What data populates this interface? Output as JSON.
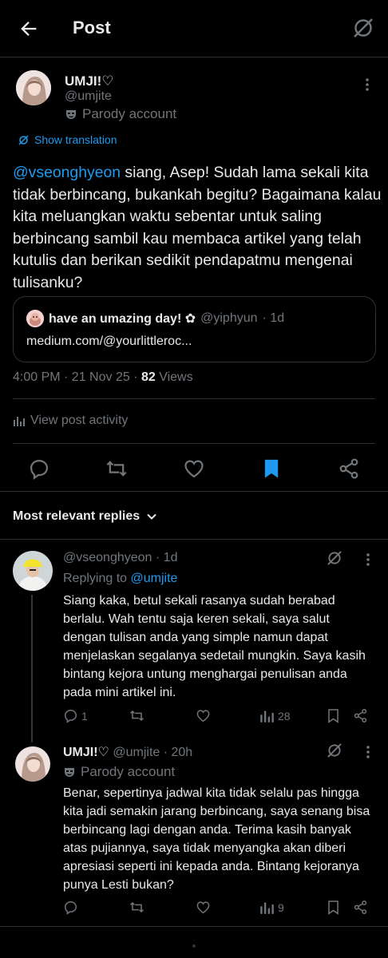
{
  "header": {
    "title": "Post"
  },
  "post": {
    "author_name": "UMJI!♡",
    "author_handle": "@umjite",
    "parody_label": "Parody account",
    "show_translation": "Show translation",
    "mention": "@vseonghyeon",
    "text": " siang, Asep! Sudah lama sekali kita tidak berbincang, bukankah begitu? Bagaimana kalau kita meluangkan waktu sebentar untuk saling berbincang sambil kau membaca artikel yang telah kutulis dan berikan sedikit pendapatmu mengenai tulisanku?",
    "quote": {
      "name": "have an umazing day! ✿",
      "handle": "@yiphyun",
      "age": "· 1d",
      "link": "medium.com/@yourlittleroc..."
    },
    "time": "4:00 PM · 21 Nov 25 · ",
    "views_count": "82",
    "views_label": " Views",
    "view_activity": "View post activity"
  },
  "replies_filter": "Most relevant replies",
  "replies": [
    {
      "handle": "@vseonghyeon",
      "age": "· 1d",
      "replying_to_label": "Replying to ",
      "replying_to": "@umjite",
      "text": "Siang kaka, betul sekali rasanya sudah berabad berlalu. Wah tentu saja keren sekali, saya salut dengan tulisan anda yang simple namun dapat menjelaskan segalanya sedetail mungkin. Saya kasih bintang kejora untung menghargai penulisan anda pada mini artikel ini.",
      "reply_count": "1",
      "views": "28"
    },
    {
      "name": "UMJI!♡",
      "handle": "@umjite",
      "age": "· 20h",
      "parody_label": "Parody account",
      "text": "Benar, sepertinya jadwal kita tidak selalu pas hingga kita jadi semakin jarang berbincang, saya senang bisa berbincang lagi dengan anda. Terima kasih banyak atas pujiannya, saya tidak menyangka akan diberi apresiasi seperti ini kepada anda. Bintang kejoranya punya Lesti bukan?",
      "views": "9"
    }
  ],
  "colors": {
    "accent": "#1d9bf0",
    "muted": "#71767b",
    "text": "#e7e9ea",
    "background": "#000000",
    "border": "#2f3336"
  }
}
